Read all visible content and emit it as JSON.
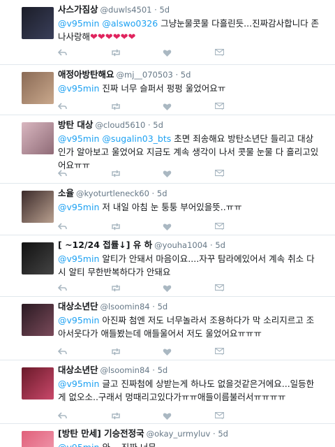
{
  "tweets": [
    {
      "name": "사스가짐상",
      "handle": "@duwls4501",
      "time": "5d",
      "mentions": [
        "@v95min",
        "@alswo0326"
      ],
      "text": "그냥눈물콧물 다흘린듯...진짜감사합니다 존나사랑해",
      "emoji": "❤❤❤❤❤❤",
      "avatar_colors": [
        "#1b1d28",
        "#3a3f5a"
      ]
    },
    {
      "name": "애정아방탄해요",
      "handle": "@mj__070503",
      "time": "5d",
      "mentions": [
        "@v95min"
      ],
      "text": "진짜 너무 슬퍼서 펑펑 울었어요ㅠ",
      "emoji": "",
      "avatar_colors": [
        "#8a6a55",
        "#c9a88c"
      ]
    },
    {
      "name": "방탄 대상",
      "handle": "@cloud5610",
      "time": "5d",
      "mentions": [
        "@v95min",
        "@sugalin03_bts"
      ],
      "text": "초면 죄송해요 방탄소년단 들리고 대상인가 알아보고 울었어요 지금도 계속 생각이 나서 콧물 눈물 다 흘리고있어요ㅠㅠ",
      "emoji": "",
      "avatar_colors": [
        "#d9b7c0",
        "#8f6b77"
      ]
    },
    {
      "name": "소율",
      "handle": "@kyoturtleneck60",
      "time": "5d",
      "mentions": [
        "@v95min"
      ],
      "text": "저 내일 아침 눈 퉁퉁 부어있을뜻..ㅠㅠ",
      "emoji": "",
      "avatar_colors": [
        "#3b2a2a",
        "#b9a08f"
      ]
    },
    {
      "name": "[ ~12/24 접률↓] 유 하",
      "handle": "@youha1004",
      "time": "5d",
      "mentions": [
        "@v95min"
      ],
      "text": "알티가 안돼서 마음이요....자꾸 탐라에있어서 계속 취소 다시 알티 무한반복하다가 안돼요",
      "emoji": "",
      "avatar_colors": [
        "#111111",
        "#444444"
      ]
    },
    {
      "name": "대상소년단",
      "handle": "@lsoomin84",
      "time": "5d",
      "mentions": [
        "@v95min"
      ],
      "text": "아진짜 첨엔 저도 너무놀라서 조용하다가 막 소리지르고 조아서웃다가 애들봤는데 애들울어서 저도 울었어요ㅠㅠㅠ",
      "emoji": "",
      "avatar_colors": [
        "#2a1a22",
        "#7a4a5a"
      ]
    },
    {
      "name": "대상소년단",
      "handle": "@lsoomin84",
      "time": "5d",
      "mentions": [
        "@v95min"
      ],
      "text": "글고 진짜첨에 상받는게 하나도 없을것같은거에요...일등한게 없오소..구래서 멍때리고있다가ㅠㅠ애들이름불러서ㅠㅠㅠㅠ",
      "emoji": "",
      "avatar_colors": [
        "#6a1a2a",
        "#c9486a"
      ]
    },
    {
      "name": "[방탄 만세] 기승전정국",
      "handle": "@okay_urmyluv",
      "time": "5d",
      "mentions": [
        "@v95min"
      ],
      "text": "와... 진짜 너무",
      "emoji": "",
      "avatar_colors": [
        "#e0607a",
        "#f3a0b4"
      ]
    }
  ],
  "colors": {
    "link": "#1da1f2",
    "muted": "#657786",
    "action_icon": "#aab8c2",
    "divider": "#e1e8ed"
  },
  "icons": [
    "reply-icon",
    "retweet-icon",
    "like-icon",
    "dm-icon"
  ]
}
